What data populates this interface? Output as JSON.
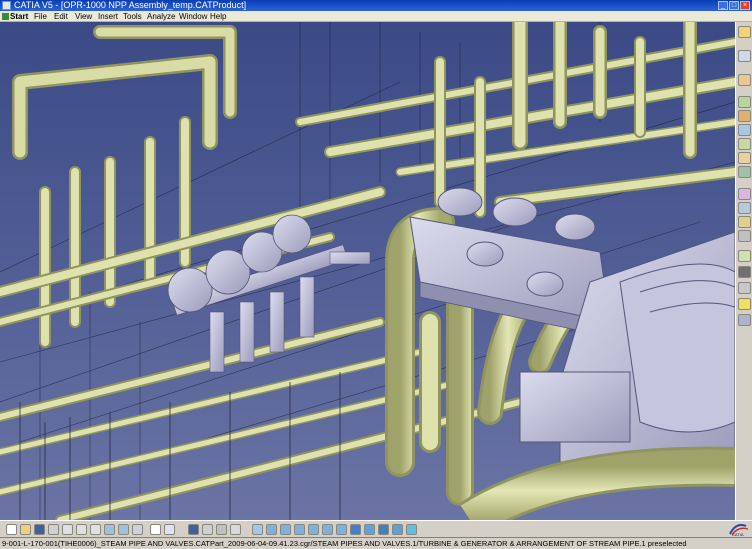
{
  "window": {
    "title": "CATIA V5 - [OPR-1000 NPP Assembly_temp.CATProduct]",
    "app_icon": "catia-app-icon",
    "controls": [
      "minimize-icon",
      "maximize-icon",
      "close-icon"
    ]
  },
  "menubar": {
    "items": [
      {
        "label": "Start"
      },
      {
        "label": "File"
      },
      {
        "label": "Edit"
      },
      {
        "label": "View"
      },
      {
        "label": "Insert"
      },
      {
        "label": "Tools"
      },
      {
        "label": "Analyze"
      },
      {
        "label": "Window"
      },
      {
        "label": "Help"
      }
    ]
  },
  "viewport": {
    "description_colors": {
      "background_top": "#3b4a86",
      "background_bottom": "#6b74a4",
      "pipe": "#d9dca4",
      "pipe_shadow": "#a8ac70",
      "equipment": "#b9b9d4"
    }
  },
  "status": {
    "text": "9-001-L-170-001(TIHE0006)_STEAM PIPE AND VALVES.CATPart_2009-06-04-09.41.23.cgr/STEAM PIPES AND VALVES.1/TURBINE & GENERATOR & ARRANGEMENT OF STREAM PIPE.1 preselected"
  },
  "logo": "CATIA"
}
